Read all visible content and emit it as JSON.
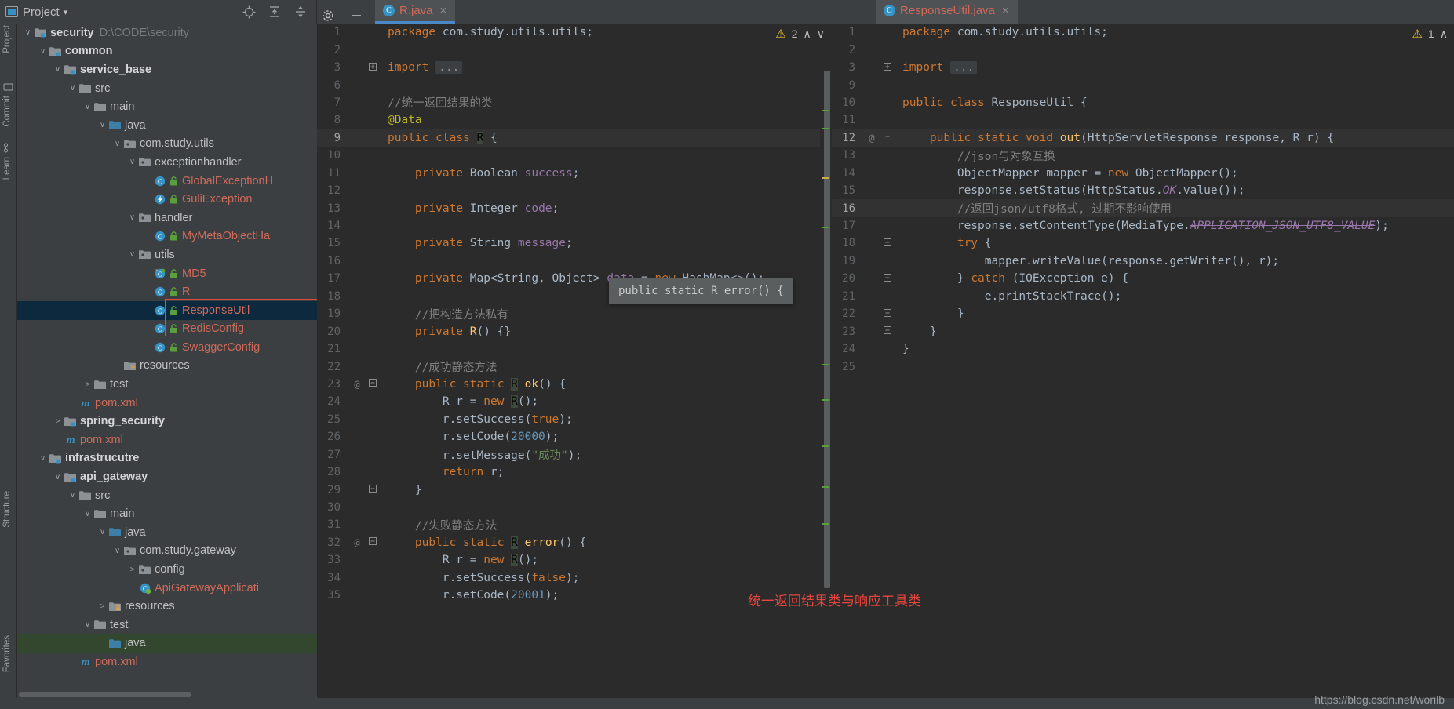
{
  "window": {
    "tool_window_title": "Project",
    "project_path_label": "D:\\CODE\\security"
  },
  "toolbar": {
    "locate_icon": "crosshair-target-icon",
    "expand_icon": "expand-all-icon",
    "collapse_icon": "collapse-all-icon",
    "settings_icon": "gear-icon",
    "hide_icon": "minimize-icon"
  },
  "rails": {
    "left": [
      "Project",
      "Commit",
      "Learn",
      "Structure",
      "Favorites"
    ]
  },
  "tree": [
    {
      "depth": 0,
      "arrow": "v",
      "icon": "module-folder",
      "label": "security",
      "bold": true,
      "path": "D:\\CODE\\security"
    },
    {
      "depth": 1,
      "arrow": "v",
      "icon": "module-folder",
      "label": "common",
      "bold": true
    },
    {
      "depth": 2,
      "arrow": "v",
      "icon": "module-folder",
      "label": "service_base",
      "bold": true
    },
    {
      "depth": 3,
      "arrow": "v",
      "icon": "folder-gray",
      "label": "src"
    },
    {
      "depth": 4,
      "arrow": "v",
      "icon": "folder-gray",
      "label": "main"
    },
    {
      "depth": 5,
      "arrow": "v",
      "icon": "folder-source",
      "label": "java"
    },
    {
      "depth": 6,
      "arrow": "v",
      "icon": "package",
      "label": "com.study.utils"
    },
    {
      "depth": 7,
      "arrow": "v",
      "icon": "package",
      "label": "exceptionhandler"
    },
    {
      "depth": 8,
      "arrow": "",
      "icon": "class",
      "label": "GlobalExceptionH",
      "red": true,
      "lock": true
    },
    {
      "depth": 8,
      "arrow": "",
      "icon": "exception",
      "label": "GuliException",
      "red": true,
      "lock": true
    },
    {
      "depth": 7,
      "arrow": "v",
      "icon": "package",
      "label": "handler"
    },
    {
      "depth": 8,
      "arrow": "",
      "icon": "class",
      "label": "MyMetaObjectHa",
      "red": true,
      "lock": true
    },
    {
      "depth": 7,
      "arrow": "v",
      "icon": "package",
      "label": "utils"
    },
    {
      "depth": 8,
      "arrow": "",
      "icon": "class-run",
      "label": "MD5",
      "red": true,
      "lock": true
    },
    {
      "depth": 8,
      "arrow": "",
      "icon": "class",
      "label": "R",
      "red": true,
      "lock": true,
      "boxed": true
    },
    {
      "depth": 8,
      "arrow": "",
      "icon": "class",
      "label": "ResponseUtil",
      "red": true,
      "lock": true,
      "selected": true,
      "boxed": true
    },
    {
      "depth": 8,
      "arrow": "",
      "icon": "class",
      "label": "RedisConfig",
      "red": true,
      "lock": true
    },
    {
      "depth": 8,
      "arrow": "",
      "icon": "class",
      "label": "SwaggerConfig",
      "red": true,
      "lock": true
    },
    {
      "depth": 6,
      "arrow": "",
      "icon": "resources",
      "label": "resources"
    },
    {
      "depth": 4,
      "arrow": ">",
      "icon": "folder-gray",
      "label": "test"
    },
    {
      "depth": 3,
      "arrow": "",
      "icon": "maven",
      "label": "pom.xml",
      "red": true
    },
    {
      "depth": 2,
      "arrow": ">",
      "icon": "module-folder",
      "label": "spring_security",
      "bold": true
    },
    {
      "depth": 2,
      "arrow": "",
      "icon": "maven",
      "label": "pom.xml",
      "red": true
    },
    {
      "depth": 1,
      "arrow": "v",
      "icon": "module-folder",
      "label": "infrastrucutre",
      "bold": true
    },
    {
      "depth": 2,
      "arrow": "v",
      "icon": "module-folder",
      "label": "api_gateway",
      "bold": true
    },
    {
      "depth": 3,
      "arrow": "v",
      "icon": "folder-gray",
      "label": "src"
    },
    {
      "depth": 4,
      "arrow": "v",
      "icon": "folder-gray",
      "label": "main"
    },
    {
      "depth": 5,
      "arrow": "v",
      "icon": "folder-source",
      "label": "java"
    },
    {
      "depth": 6,
      "arrow": "v",
      "icon": "package",
      "label": "com.study.gateway"
    },
    {
      "depth": 7,
      "arrow": ">",
      "icon": "package",
      "label": "config"
    },
    {
      "depth": 7,
      "arrow": "",
      "icon": "spring-class",
      "label": "ApiGatewayApplicati",
      "red": true
    },
    {
      "depth": 5,
      "arrow": ">",
      "icon": "resources",
      "label": "resources"
    },
    {
      "depth": 4,
      "arrow": "v",
      "icon": "folder-gray",
      "label": "test"
    },
    {
      "depth": 5,
      "arrow": "",
      "icon": "folder-source",
      "label": "java",
      "greenSelected": true
    },
    {
      "depth": 3,
      "arrow": "",
      "icon": "maven",
      "label": "pom.xml",
      "red": true
    }
  ],
  "editor_left": {
    "tab": {
      "label": "R.java",
      "icon": "java-class-icon",
      "close": "×"
    },
    "inspection": {
      "count": "2",
      "icon": "warning-triangle-icon",
      "up": "∧",
      "down": "∨"
    },
    "lines": [
      {
        "n": "1",
        "code": [
          {
            "t": "package",
            "c": "kw"
          },
          {
            "t": " com.study.utils.utils;",
            "c": "pln"
          }
        ]
      },
      {
        "n": "2",
        "code": []
      },
      {
        "n": "3",
        "fold": "+",
        "code": [
          {
            "t": "import",
            "c": "kw"
          },
          {
            "t": " ",
            "c": "pln"
          },
          {
            "t": "...",
            "c": "dots"
          }
        ]
      },
      {
        "n": "6",
        "code": []
      },
      {
        "n": "7",
        "code": [
          {
            "t": "//统一返回结果的类",
            "c": "cmt"
          }
        ]
      },
      {
        "n": "8",
        "code": [
          {
            "t": "@Data",
            "c": "ann"
          }
        ]
      },
      {
        "n": "9",
        "hl": true,
        "code": [
          {
            "t": "public",
            "c": "kw"
          },
          {
            "t": " ",
            "c": "pln"
          },
          {
            "t": "class",
            "c": "kw"
          },
          {
            "t": " ",
            "c": "pln"
          },
          {
            "t": "R",
            "c": "rhl"
          },
          {
            "t": " {",
            "c": "pln"
          }
        ]
      },
      {
        "n": "10",
        "code": []
      },
      {
        "n": "11",
        "code": [
          {
            "t": "    ",
            "c": "pln"
          },
          {
            "t": "private",
            "c": "kw"
          },
          {
            "t": " Boolean ",
            "c": "typ"
          },
          {
            "t": "success",
            "c": "fld"
          },
          {
            "t": ";",
            "c": "pln"
          }
        ]
      },
      {
        "n": "12",
        "code": []
      },
      {
        "n": "13",
        "code": [
          {
            "t": "    ",
            "c": "pln"
          },
          {
            "t": "private",
            "c": "kw"
          },
          {
            "t": " Integer ",
            "c": "typ"
          },
          {
            "t": "code",
            "c": "fld"
          },
          {
            "t": ";",
            "c": "pln"
          }
        ]
      },
      {
        "n": "14",
        "code": []
      },
      {
        "n": "15",
        "code": [
          {
            "t": "    ",
            "c": "pln"
          },
          {
            "t": "private",
            "c": "kw"
          },
          {
            "t": " String ",
            "c": "typ"
          },
          {
            "t": "message",
            "c": "fld"
          },
          {
            "t": ";",
            "c": "pln"
          }
        ]
      },
      {
        "n": "16",
        "code": []
      },
      {
        "n": "17",
        "code": [
          {
            "t": "    ",
            "c": "pln"
          },
          {
            "t": "private",
            "c": "kw"
          },
          {
            "t": " Map<String, Object> ",
            "c": "typ"
          },
          {
            "t": "data",
            "c": "fld"
          },
          {
            "t": " = ",
            "c": "pln"
          },
          {
            "t": "new",
            "c": "kw"
          },
          {
            "t": " HashMap<>();",
            "c": "pln"
          }
        ]
      },
      {
        "n": "18",
        "code": []
      },
      {
        "n": "19",
        "code": [
          {
            "t": "    ",
            "c": "pln"
          },
          {
            "t": "//把构造方法私有",
            "c": "cmt"
          }
        ]
      },
      {
        "n": "20",
        "code": [
          {
            "t": "    ",
            "c": "pln"
          },
          {
            "t": "private",
            "c": "kw"
          },
          {
            "t": " ",
            "c": "pln"
          },
          {
            "t": "R",
            "c": "mth"
          },
          {
            "t": "() {}",
            "c": "pln"
          }
        ]
      },
      {
        "n": "21",
        "code": []
      },
      {
        "n": "22",
        "code": [
          {
            "t": "    ",
            "c": "pln"
          },
          {
            "t": "//成功静态方法",
            "c": "cmt"
          }
        ]
      },
      {
        "n": "23",
        "marks": "@",
        "fold": "-",
        "code": [
          {
            "t": "    ",
            "c": "pln"
          },
          {
            "t": "public",
            "c": "kw"
          },
          {
            "t": " ",
            "c": "pln"
          },
          {
            "t": "static",
            "c": "kw"
          },
          {
            "t": " ",
            "c": "pln"
          },
          {
            "t": "R",
            "c": "rhl"
          },
          {
            "t": " ",
            "c": "pln"
          },
          {
            "t": "ok",
            "c": "mth"
          },
          {
            "t": "() {",
            "c": "pln"
          }
        ]
      },
      {
        "n": "24",
        "code": [
          {
            "t": "        R r = ",
            "c": "pln"
          },
          {
            "t": "new",
            "c": "kw"
          },
          {
            "t": " ",
            "c": "pln"
          },
          {
            "t": "R",
            "c": "rhl"
          },
          {
            "t": "();",
            "c": "pln"
          }
        ]
      },
      {
        "n": "25",
        "code": [
          {
            "t": "        r.setSuccess(",
            "c": "pln"
          },
          {
            "t": "true",
            "c": "kw"
          },
          {
            "t": ");",
            "c": "pln"
          }
        ]
      },
      {
        "n": "26",
        "code": [
          {
            "t": "        r.setCode(",
            "c": "pln"
          },
          {
            "t": "20000",
            "c": "num"
          },
          {
            "t": ");",
            "c": "pln"
          }
        ]
      },
      {
        "n": "27",
        "code": [
          {
            "t": "        r.setMessage(",
            "c": "pln"
          },
          {
            "t": "\"成功\"",
            "c": "str"
          },
          {
            "t": ");",
            "c": "pln"
          }
        ]
      },
      {
        "n": "28",
        "code": [
          {
            "t": "        ",
            "c": "pln"
          },
          {
            "t": "return",
            "c": "kw"
          },
          {
            "t": " r;",
            "c": "pln"
          }
        ]
      },
      {
        "n": "29",
        "fold": "-",
        "code": [
          {
            "t": "    }",
            "c": "pln"
          }
        ]
      },
      {
        "n": "30",
        "code": []
      },
      {
        "n": "31",
        "code": [
          {
            "t": "    ",
            "c": "pln"
          },
          {
            "t": "//失败静态方法",
            "c": "cmt"
          }
        ]
      },
      {
        "n": "32",
        "marks": "@",
        "fold": "-",
        "code": [
          {
            "t": "    ",
            "c": "pln"
          },
          {
            "t": "public",
            "c": "kw"
          },
          {
            "t": " ",
            "c": "pln"
          },
          {
            "t": "static",
            "c": "kw"
          },
          {
            "t": " ",
            "c": "pln"
          },
          {
            "t": "R",
            "c": "rhl"
          },
          {
            "t": " ",
            "c": "pln"
          },
          {
            "t": "error",
            "c": "mth"
          },
          {
            "t": "() {",
            "c": "pln"
          }
        ]
      },
      {
        "n": "33",
        "code": [
          {
            "t": "        R r = ",
            "c": "pln"
          },
          {
            "t": "new",
            "c": "kw"
          },
          {
            "t": " ",
            "c": "pln"
          },
          {
            "t": "R",
            "c": "rhl"
          },
          {
            "t": "();",
            "c": "pln"
          }
        ]
      },
      {
        "n": "34",
        "code": [
          {
            "t": "        r.setSuccess(",
            "c": "pln"
          },
          {
            "t": "false",
            "c": "kw"
          },
          {
            "t": ");",
            "c": "pln"
          }
        ]
      },
      {
        "n": "35",
        "code": [
          {
            "t": "        r.setCode(",
            "c": "pln"
          },
          {
            "t": "20001",
            "c": "num"
          },
          {
            "t": ");",
            "c": "pln"
          }
        ]
      }
    ],
    "tooltip": "public static R error() {"
  },
  "editor_right": {
    "tab": {
      "label": "ResponseUtil.java",
      "icon": "java-class-icon",
      "close": "×"
    },
    "inspection": {
      "count": "1",
      "icon": "warning-triangle-icon",
      "up": "∧"
    },
    "lines": [
      {
        "n": "1",
        "code": [
          {
            "t": "package",
            "c": "kw"
          },
          {
            "t": " com.study.utils.utils;",
            "c": "pln"
          }
        ]
      },
      {
        "n": "2",
        "code": []
      },
      {
        "n": "3",
        "fold": "+",
        "code": [
          {
            "t": "import",
            "c": "kw"
          },
          {
            "t": " ",
            "c": "pln"
          },
          {
            "t": "...",
            "c": "dots"
          }
        ]
      },
      {
        "n": "9",
        "code": []
      },
      {
        "n": "10",
        "code": [
          {
            "t": "public",
            "c": "kw"
          },
          {
            "t": " ",
            "c": "pln"
          },
          {
            "t": "class",
            "c": "kw"
          },
          {
            "t": " ResponseUtil {",
            "c": "pln"
          }
        ]
      },
      {
        "n": "11",
        "code": []
      },
      {
        "n": "12",
        "hl": true,
        "marks": "@",
        "fold": "-",
        "code": [
          {
            "t": "    ",
            "c": "pln"
          },
          {
            "t": "public",
            "c": "kw"
          },
          {
            "t": " ",
            "c": "pln"
          },
          {
            "t": "static",
            "c": "kw"
          },
          {
            "t": " ",
            "c": "pln"
          },
          {
            "t": "void",
            "c": "kw"
          },
          {
            "t": " ",
            "c": "pln"
          },
          {
            "t": "out",
            "c": "mth"
          },
          {
            "t": "(HttpServletResponse ",
            "c": "pln"
          },
          {
            "t": "response",
            "c": "pln"
          },
          {
            "t": ", R ",
            "c": "pln"
          },
          {
            "t": "r",
            "c": "pln"
          },
          {
            "t": ") {",
            "c": "pln"
          }
        ]
      },
      {
        "n": "13",
        "code": [
          {
            "t": "        ",
            "c": "pln"
          },
          {
            "t": "//json与对象互换",
            "c": "cmt"
          }
        ]
      },
      {
        "n": "14",
        "code": [
          {
            "t": "        ObjectMapper mapper = ",
            "c": "pln"
          },
          {
            "t": "new",
            "c": "kw"
          },
          {
            "t": " ObjectMapper();",
            "c": "pln"
          }
        ]
      },
      {
        "n": "15",
        "code": [
          {
            "t": "        response.setStatus(HttpStatus.",
            "c": "pln"
          },
          {
            "t": "OK",
            "c": "cnst"
          },
          {
            "t": ".value());",
            "c": "pln"
          }
        ]
      },
      {
        "n": "16",
        "hl": true,
        "code": [
          {
            "t": "        ",
            "c": "pln"
          },
          {
            "t": "//返回json/utf8格式, 过期不影响使用",
            "c": "cmt"
          }
        ]
      },
      {
        "n": "17",
        "code": [
          {
            "t": "        response.setContentType(MediaType.",
            "c": "pln"
          },
          {
            "t": "APPLICATION_JSON_UTF8_VALUE",
            "c": "cnst-strike"
          },
          {
            "t": ");",
            "c": "pln"
          }
        ]
      },
      {
        "n": "18",
        "fold": "-",
        "code": [
          {
            "t": "        ",
            "c": "pln"
          },
          {
            "t": "try",
            "c": "kw"
          },
          {
            "t": " {",
            "c": "pln"
          }
        ]
      },
      {
        "n": "19",
        "code": [
          {
            "t": "            mapper.writeValue(response.getWriter(), r);",
            "c": "pln"
          }
        ]
      },
      {
        "n": "20",
        "fold": "-",
        "code": [
          {
            "t": "        } ",
            "c": "pln"
          },
          {
            "t": "catch",
            "c": "kw"
          },
          {
            "t": " (IOException e) {",
            "c": "pln"
          }
        ]
      },
      {
        "n": "21",
        "code": [
          {
            "t": "            e.printStackTrace();",
            "c": "pln"
          }
        ]
      },
      {
        "n": "22",
        "fold": "-",
        "code": [
          {
            "t": "        }",
            "c": "pln"
          }
        ]
      },
      {
        "n": "23",
        "fold": "-",
        "code": [
          {
            "t": "    }",
            "c": "pln"
          }
        ]
      },
      {
        "n": "24",
        "code": [
          {
            "t": "}",
            "c": "pln"
          }
        ]
      },
      {
        "n": "25",
        "code": []
      }
    ]
  },
  "annotation": {
    "text": "统一返回结果类与响应工具类",
    "color": "#e8453c"
  },
  "watermark": "https://blog.csdn.net/worilb"
}
